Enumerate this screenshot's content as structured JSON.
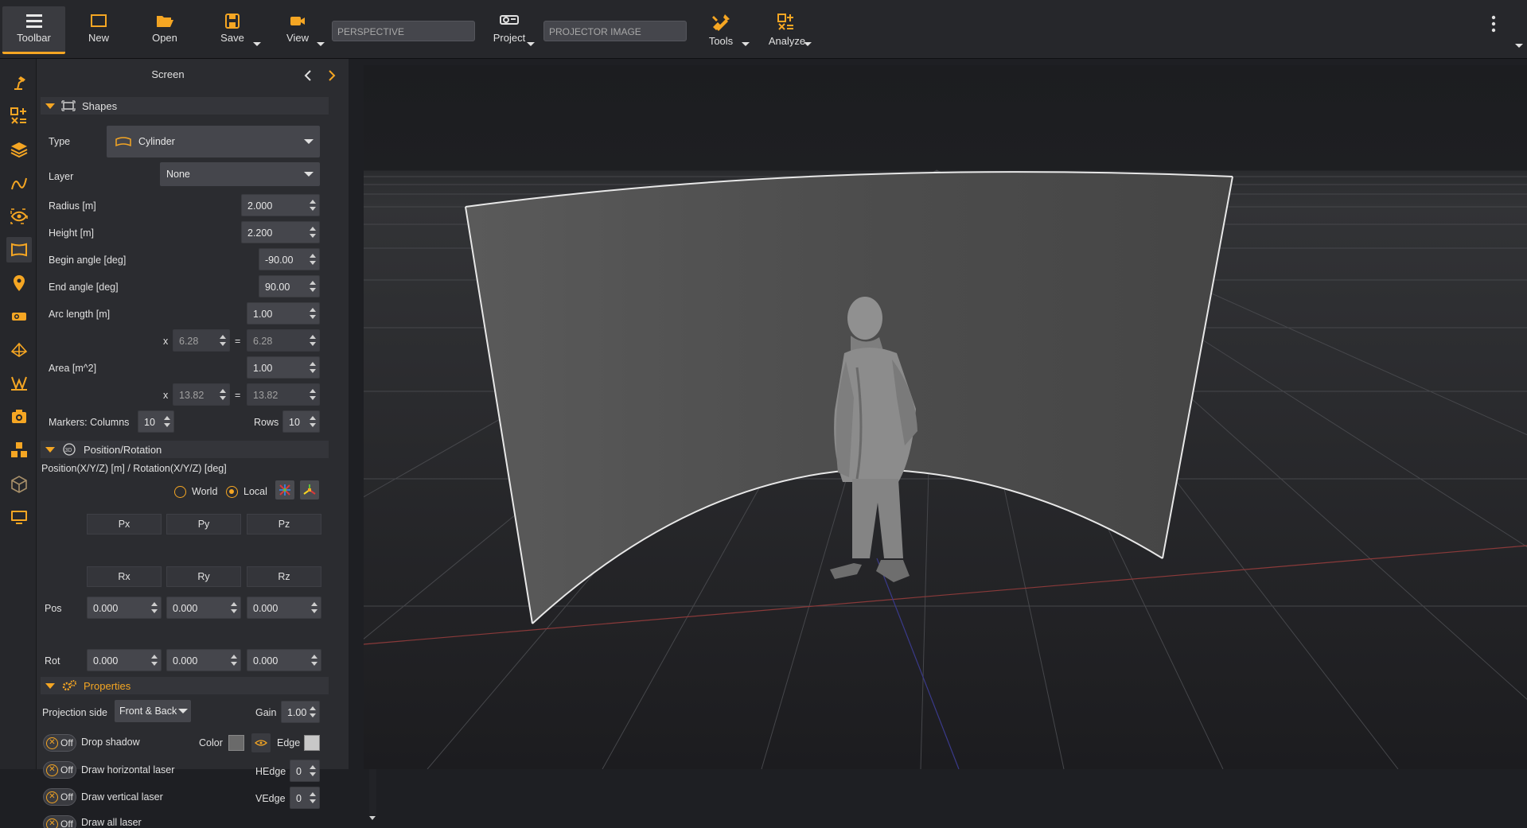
{
  "toolbar": {
    "toolbar_label": "Toolbar",
    "new_label": "New",
    "open_label": "Open",
    "save_label": "Save",
    "view_label": "View",
    "view_field": "PERSPECTIVE",
    "project_label": "Project",
    "project_field": "PROJECTOR IMAGE",
    "tools_label": "Tools",
    "analyze_label": "Analyze"
  },
  "panel": {
    "title": "Screen",
    "shapes": {
      "header": "Shapes",
      "type_label": "Type",
      "type_value": "Cylinder",
      "layer_label": "Layer",
      "layer_value": "None",
      "radius_label": "Radius  [m]",
      "radius_value": "2.000",
      "height_label": "Height  [m]",
      "height_value": "2.200",
      "begin_label": "Begin angle [deg]",
      "begin_value": "-90.00",
      "end_label": "End angle [deg]",
      "end_value": "90.00",
      "arc_label": "Arc length  [m]",
      "arc_value": "1.00",
      "arc_x": "x",
      "arc_mult": "6.28",
      "arc_eq": "=",
      "arc_result": "6.28",
      "area_label": "Area  [m^2]",
      "area_value": "1.00",
      "area_x": "x",
      "area_mult": "13.82",
      "area_eq": "=",
      "area_result": "13.82",
      "markers_label": "Markers:  Columns",
      "columns_value": "10",
      "rows_label": "Rows",
      "rows_value": "10"
    },
    "position": {
      "header": "Position/Rotation",
      "desc": "Position(X/Y/Z) [m] / Rotation(X/Y/Z) [deg]",
      "world_label": "World",
      "local_label": "Local",
      "px": "Px",
      "py": "Py",
      "pz": "Pz",
      "rx": "Rx",
      "ry": "Ry",
      "rz": "Rz",
      "pos_label": "Pos",
      "rot_label": "Rot",
      "pos_x": "0.000",
      "pos_y": "0.000",
      "pos_z": "0.000",
      "rot_x": "0.000",
      "rot_y": "0.000",
      "rot_z": "0.000"
    },
    "properties": {
      "header": "Properties",
      "proj_side_label": "Projection side",
      "proj_side_value": "Front & Back",
      "gain_label": "Gain",
      "gain_value": "1.00",
      "toggle_off": "Off",
      "drop_shadow": "Drop shadow",
      "color_label": "Color",
      "edge_label": "Edge",
      "hlaser": "Draw horizontal laser",
      "hedge_label": "HEdge",
      "hedge_value": "0",
      "vlaser": "Draw vertical laser",
      "vedge_label": "VEdge",
      "vedge_value": "0",
      "all_laser": "Draw all laser"
    }
  },
  "colors": {
    "accent": "#f5a623",
    "screen_gray": "#4a4a4a"
  }
}
